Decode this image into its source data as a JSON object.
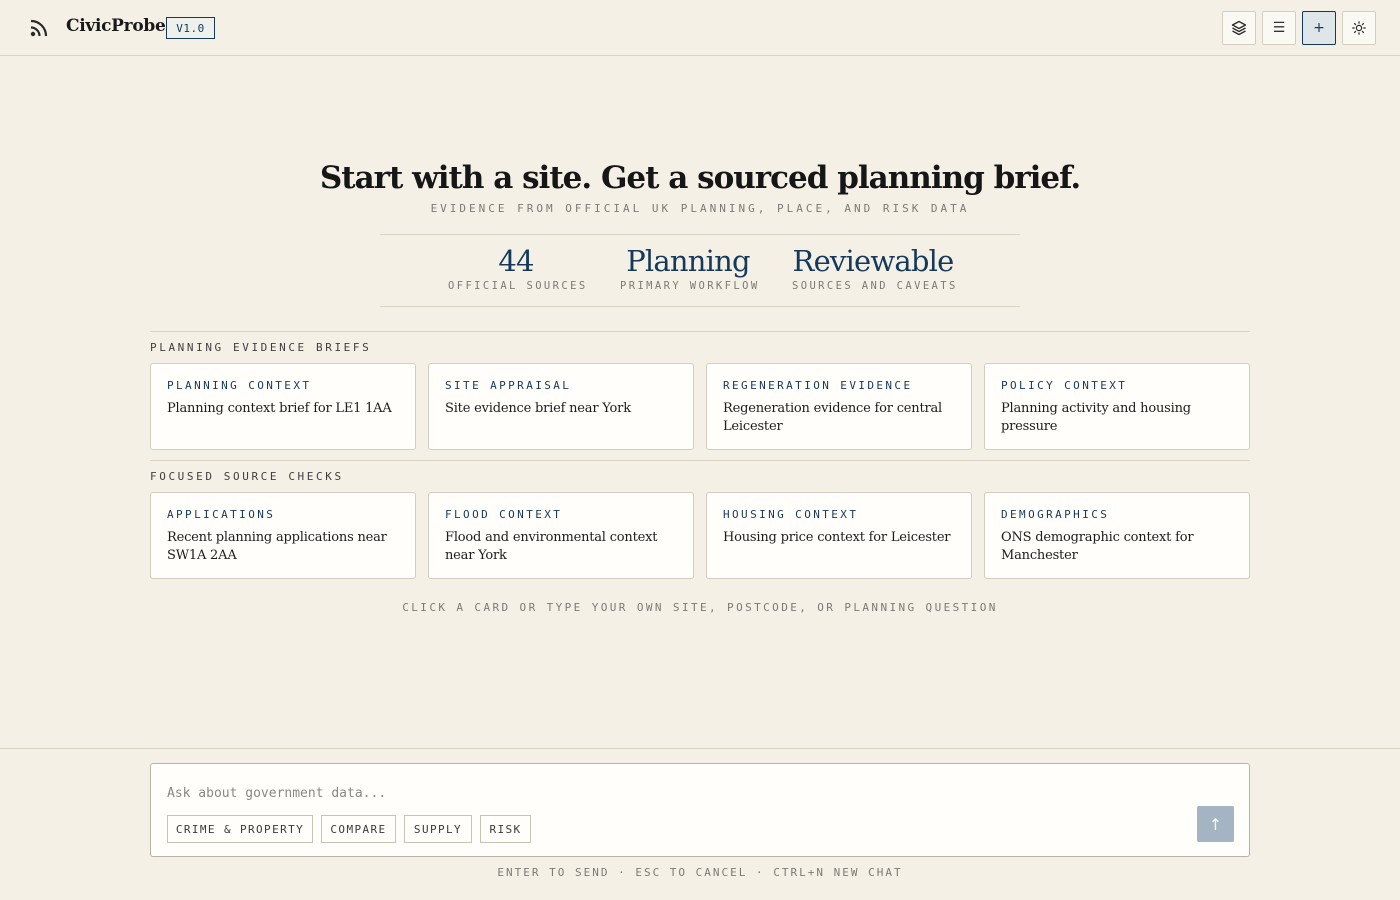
{
  "header": {
    "brand": "CivicProbe",
    "version": "V1.0",
    "buttons": [
      {
        "icon": "layers-icon"
      },
      {
        "icon": "menu-icon",
        "glyph": "☰"
      },
      {
        "icon": "plus-icon",
        "glyph": "+"
      },
      {
        "icon": "sun-icon"
      }
    ]
  },
  "hero": {
    "title": "Start with a site. Get a sourced planning brief.",
    "subtitle": "EVIDENCE FROM OFFICIAL UK PLANNING, PLACE, AND RISK DATA",
    "stats": [
      {
        "value": "44",
        "label": "OFFICIAL SOURCES"
      },
      {
        "value": "Planning",
        "label": "PRIMARY WORKFLOW"
      },
      {
        "value": "Reviewable",
        "label": "SOURCES AND CAVEATS"
      }
    ]
  },
  "sections": [
    {
      "label": "PLANNING EVIDENCE BRIEFS",
      "cards": [
        {
          "kicker": "PLANNING CONTEXT",
          "title": "Planning context brief for LE1 1AA"
        },
        {
          "kicker": "SITE APPRAISAL",
          "title": "Site evidence brief near York"
        },
        {
          "kicker": "REGENERATION EVIDENCE",
          "title": "Regeneration evidence for central Leicester"
        },
        {
          "kicker": "POLICY CONTEXT",
          "title": "Planning activity and housing pressure"
        }
      ]
    },
    {
      "label": "FOCUSED SOURCE CHECKS",
      "cards": [
        {
          "kicker": "APPLICATIONS",
          "title": "Recent planning applications near SW1A 2AA"
        },
        {
          "kicker": "FLOOD CONTEXT",
          "title": "Flood and environmental context near York"
        },
        {
          "kicker": "HOUSING CONTEXT",
          "title": "Housing price context for Leicester"
        },
        {
          "kicker": "DEMOGRAPHICS",
          "title": "ONS demographic context for Manchester"
        }
      ]
    }
  ],
  "hint": "CLICK A CARD OR TYPE YOUR OWN SITE, POSTCODE, OR PLANNING QUESTION",
  "composer": {
    "placeholder": "Ask about government data...",
    "value": "",
    "chips": [
      "CRIME & PROPERTY",
      "COMPARE",
      "SUPPLY",
      "RISK"
    ],
    "send_glyph": "↑"
  },
  "shortcuts": "ENTER TO SEND · ESC TO CANCEL · CTRL+N NEW CHAT",
  "colors": {
    "background": "#f4f0e6",
    "accent": "#15395a",
    "send_disabled": "#a4b4c2"
  }
}
